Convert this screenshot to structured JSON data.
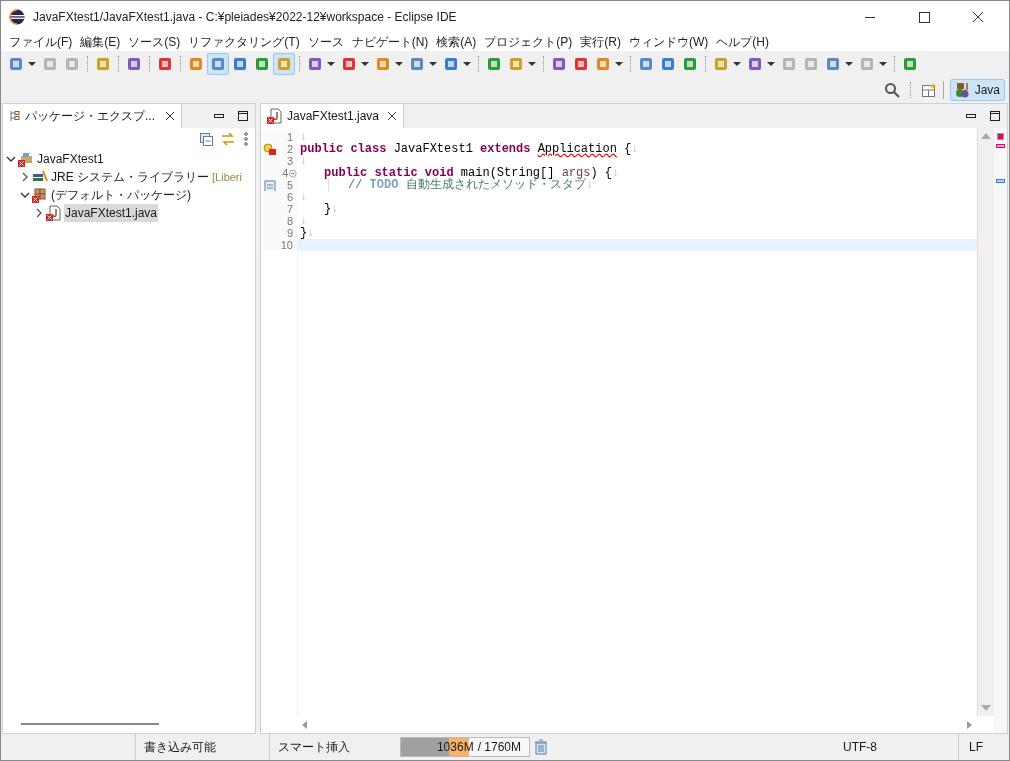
{
  "window": {
    "title": "JavaFXtest1/JavaFXtest1.java - C:¥pleiades¥2022-12¥workspace - Eclipse IDE"
  },
  "menu": [
    "ファイル(F)",
    "編集(E)",
    "ソース(S)",
    "リファクタリング(T)",
    "ソース",
    "ナビゲート(N)",
    "検索(A)",
    "プロジェクト(P)",
    "実行(R)",
    "ウィンドウ(W)",
    "ヘルプ(H)"
  ],
  "toolbar": [
    [
      {
        "pressed": false,
        "menu": true,
        "disabled": false
      },
      {
        "pressed": false,
        "menu": false,
        "disabled": true
      },
      {
        "pressed": false,
        "menu": false,
        "disabled": true
      }
    ],
    [
      {
        "pressed": false,
        "menu": false,
        "disabled": false
      }
    ],
    [
      {
        "pressed": false,
        "menu": false,
        "disabled": false
      }
    ],
    [
      {
        "pressed": false,
        "menu": false,
        "disabled": false
      }
    ],
    [
      {
        "pressed": false,
        "menu": false,
        "disabled": false
      },
      {
        "pressed": true,
        "menu": false,
        "disabled": false
      },
      {
        "pressed": false,
        "menu": false,
        "disabled": false
      },
      {
        "pressed": false,
        "menu": false,
        "disabled": false
      },
      {
        "pressed": true,
        "menu": false,
        "disabled": false
      }
    ],
    [
      {
        "pressed": false,
        "menu": true,
        "disabled": false
      },
      {
        "pressed": false,
        "menu": true,
        "disabled": false
      },
      {
        "pressed": false,
        "menu": true,
        "disabled": false
      },
      {
        "pressed": false,
        "menu": true,
        "disabled": false
      },
      {
        "pressed": false,
        "menu": true,
        "disabled": false
      }
    ],
    [
      {
        "pressed": false,
        "menu": false,
        "disabled": false
      },
      {
        "pressed": false,
        "menu": true,
        "disabled": false
      }
    ],
    [
      {
        "pressed": false,
        "menu": false,
        "disabled": false
      },
      {
        "pressed": false,
        "menu": false,
        "disabled": false
      },
      {
        "pressed": false,
        "menu": true,
        "disabled": false
      }
    ],
    [
      {
        "pressed": false,
        "menu": false,
        "disabled": false
      },
      {
        "pressed": false,
        "menu": false,
        "disabled": false
      },
      {
        "pressed": false,
        "menu": false,
        "disabled": false
      }
    ],
    [
      {
        "pressed": false,
        "menu": true,
        "disabled": false
      },
      {
        "pressed": false,
        "menu": true,
        "disabled": false
      },
      {
        "pressed": false,
        "menu": false,
        "disabled": true
      },
      {
        "pressed": false,
        "menu": false,
        "disabled": true
      },
      {
        "pressed": false,
        "menu": true,
        "disabled": false
      },
      {
        "pressed": false,
        "menu": true,
        "disabled": true
      }
    ],
    [
      {
        "pressed": false,
        "menu": false,
        "disabled": false
      }
    ]
  ],
  "perspective": {
    "label": "Java",
    "selected": true
  },
  "explorer": {
    "title": "パッケージ・エクスプ...",
    "tree": [
      {
        "label": "JavaFXtest1",
        "expanded": true,
        "selected": false,
        "error": true,
        "children": [
          {
            "label": "JRE システム・ライブラリー",
            "suffix": "[Liberi",
            "expanded": false,
            "selected": false,
            "error": false
          },
          {
            "label": "(デフォルト・パッケージ)",
            "expanded": true,
            "selected": false,
            "error": true,
            "children": [
              {
                "label": "JavaFXtest1.java",
                "expanded": false,
                "selected": true,
                "error": true
              }
            ]
          }
        ]
      }
    ]
  },
  "editor": {
    "tab": "JavaFXtest1.java",
    "lines": [
      {
        "number": "1",
        "current": false,
        "error": false,
        "task": false,
        "fold": false,
        "tokens": [
          {
            "kind": "ws",
            "text": "↓"
          }
        ]
      },
      {
        "number": "2",
        "current": false,
        "error": true,
        "task": false,
        "fold": false,
        "tokens": [
          {
            "kind": "keyword",
            "text": "public class "
          },
          {
            "kind": "plain",
            "text": "JavaFXtest1 "
          },
          {
            "kind": "keyword",
            "text": "extends "
          },
          {
            "kind": "error",
            "text": "Application"
          },
          {
            "kind": "plain",
            "text": " {"
          },
          {
            "kind": "ws",
            "text": "↓"
          }
        ]
      },
      {
        "number": "3",
        "current": false,
        "error": false,
        "task": false,
        "fold": false,
        "tokens": [
          {
            "kind": "ws",
            "text": "↓"
          }
        ]
      },
      {
        "number": "4",
        "current": false,
        "error": false,
        "task": false,
        "fold": true,
        "tokens": [
          {
            "kind": "indent"
          },
          {
            "kind": "keyword",
            "text": "public static void "
          },
          {
            "kind": "plain",
            "text": "main(String[] "
          },
          {
            "kind": "param",
            "text": "args"
          },
          {
            "kind": "plain",
            "text": ") {"
          },
          {
            "kind": "ws",
            "text": "↓"
          }
        ]
      },
      {
        "number": "5",
        "current": false,
        "error": false,
        "task": true,
        "fold": false,
        "tokens": [
          {
            "kind": "indent2"
          },
          {
            "kind": "comment",
            "text": "// "
          },
          {
            "kind": "todo",
            "text": "TODO"
          },
          {
            "kind": "comment",
            "text": " 自動生成されたメソッド・スタブ"
          },
          {
            "kind": "ws",
            "text": "↓"
          }
        ]
      },
      {
        "number": "6",
        "current": false,
        "error": false,
        "task": false,
        "fold": false,
        "tokens": [
          {
            "kind": "ws",
            "text": "↓"
          }
        ]
      },
      {
        "number": "7",
        "current": false,
        "error": false,
        "task": false,
        "fold": false,
        "tokens": [
          {
            "kind": "indent"
          },
          {
            "kind": "plain",
            "text": "}"
          },
          {
            "kind": "ws",
            "text": "↓"
          }
        ]
      },
      {
        "number": "8",
        "current": false,
        "error": false,
        "task": false,
        "fold": false,
        "tokens": [
          {
            "kind": "ws",
            "text": "↓"
          }
        ]
      },
      {
        "number": "9",
        "current": false,
        "error": false,
        "task": false,
        "fold": false,
        "tokens": [
          {
            "kind": "plain",
            "text": "}"
          },
          {
            "kind": "ws",
            "text": "↓"
          }
        ]
      },
      {
        "number": "10",
        "current": true,
        "error": false,
        "task": false,
        "fold": false
      }
    ]
  },
  "status_bar": {
    "writable": "書き込み可能",
    "insert_mode": "スマート挿入",
    "heap": {
      "used": "1036M",
      "total": "/ 1760M",
      "level": 0.53
    },
    "encoding": "UTF-8",
    "line_delimiter": "LF"
  }
}
